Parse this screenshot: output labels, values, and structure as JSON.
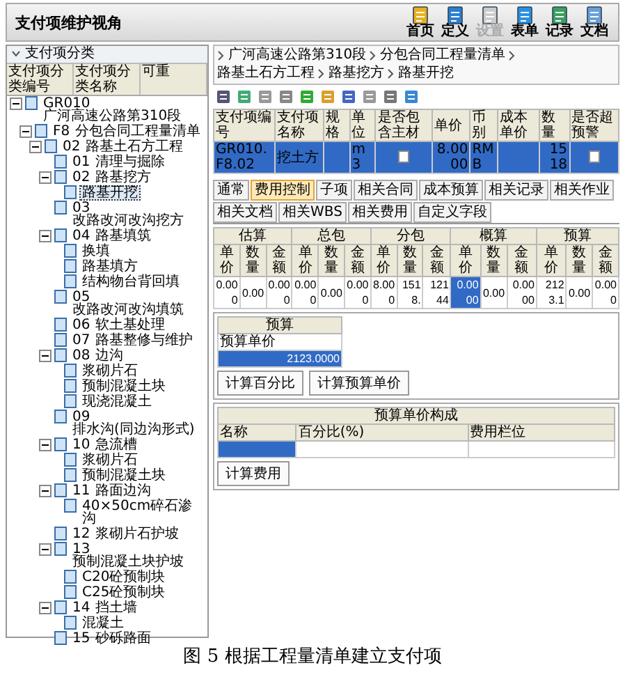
{
  "header": {
    "title": "支付项维护视角",
    "tools": [
      {
        "label": "首页",
        "disabled": false
      },
      {
        "label": "定义",
        "disabled": false
      },
      {
        "label": "设置",
        "disabled": true
      },
      {
        "label": "表单",
        "disabled": false
      },
      {
        "label": "记录",
        "disabled": false
      },
      {
        "label": "文档",
        "disabled": false
      }
    ]
  },
  "tree": {
    "title": "支付项分类",
    "columns": [
      "支付项分类编号",
      "支付项分类名称",
      "可重"
    ],
    "nodes": [
      {
        "code": "GR010",
        "name": "广河高速公路第310段",
        "selected": false,
        "expanded": true,
        "children": [
          {
            "code": "F8",
            "name": "分包合同工程量清单",
            "selected": false,
            "expanded": true,
            "children": [
              {
                "code": "02",
                "name": "路基土石方工程",
                "selected": false,
                "expanded": true,
                "children": [
                  {
                    "code": "01",
                    "name": "清理与掘除",
                    "selected": false
                  },
                  {
                    "code": "02",
                    "name": "路基挖方",
                    "selected": false,
                    "expanded": true,
                    "children": [
                      {
                        "name": "路基开挖",
                        "selected": true
                      }
                    ]
                  },
                  {
                    "code": "03",
                    "name": "改路改河改沟挖方",
                    "selected": false
                  },
                  {
                    "code": "04",
                    "name": "路基填筑",
                    "selected": false,
                    "expanded": true,
                    "children": [
                      {
                        "name": "换填",
                        "selected": false
                      },
                      {
                        "name": "路基填方",
                        "selected": false
                      },
                      {
                        "name": "结构物台背回填",
                        "selected": false
                      }
                    ]
                  },
                  {
                    "code": "05",
                    "name": "改路改河改沟填筑",
                    "selected": false
                  },
                  {
                    "code": "06",
                    "name": "软土基处理",
                    "selected": false
                  },
                  {
                    "code": "07",
                    "name": "路基整修与维护",
                    "selected": false
                  },
                  {
                    "code": "08",
                    "name": "边沟",
                    "selected": false,
                    "expanded": true,
                    "children": [
                      {
                        "name": "浆砌片石",
                        "selected": false
                      },
                      {
                        "name": "预制混凝土块",
                        "selected": false
                      },
                      {
                        "name": "现浇混凝土",
                        "selected": false
                      }
                    ]
                  },
                  {
                    "code": "09",
                    "name": "排水沟(同边沟形式)",
                    "selected": false
                  },
                  {
                    "code": "10",
                    "name": "急流槽",
                    "selected": false,
                    "expanded": true,
                    "children": [
                      {
                        "name": "浆砌片石",
                        "selected": false
                      },
                      {
                        "name": "预制混凝土块",
                        "selected": false
                      }
                    ]
                  },
                  {
                    "code": "11",
                    "name": "路面边沟",
                    "selected": false,
                    "expanded": true,
                    "children": [
                      {
                        "name": "40×50cm碎石渗沟",
                        "selected": false
                      }
                    ]
                  },
                  {
                    "code": "12",
                    "name": "浆砌片石护坡",
                    "selected": false
                  },
                  {
                    "code": "13",
                    "name": "预制混凝土块护坡",
                    "selected": false,
                    "expanded": true,
                    "children": [
                      {
                        "name": "C20砼预制块",
                        "selected": false
                      },
                      {
                        "name": "C25砼预制块",
                        "selected": false
                      }
                    ]
                  },
                  {
                    "code": "14",
                    "name": "挡土墙",
                    "selected": false,
                    "expanded": true,
                    "children": [
                      {
                        "name": "混凝土",
                        "selected": false
                      }
                    ]
                  },
                  {
                    "code": "15",
                    "name": "砂砾路面",
                    "selected": false
                  }
                ]
              }
            ]
          }
        ]
      }
    ]
  },
  "breadcrumb": [
    "广河高速公路第310段",
    "分包合同工程量清单",
    "路基土石方工程",
    "路基挖方",
    "路基开挖"
  ],
  "grid": {
    "columns": [
      "支付项编号",
      "支付项名称",
      "规格",
      "单位",
      "是否包含主材",
      "单价",
      "币别",
      "成本单价",
      "数量",
      "是否超预警"
    ],
    "rows": [
      {
        "selected": true,
        "code": "GR010.F8.02",
        "name": "挖土方",
        "unit": "m3",
        "includes_main_material": false,
        "price": "8.0000",
        "currency": "RMB",
        "quantity": "1518",
        "warning": false
      }
    ]
  },
  "tabs": [
    {
      "label": "通常",
      "selected": false
    },
    {
      "label": "费用控制",
      "selected": true
    },
    {
      "label": "子项",
      "selected": false
    },
    {
      "label": "相关合同",
      "selected": false
    },
    {
      "label": "成本预算",
      "selected": false
    },
    {
      "label": "相关记录",
      "selected": false
    },
    {
      "label": "相关作业",
      "selected": false
    },
    {
      "label": "相关文档",
      "selected": false
    },
    {
      "label": "相关WBS",
      "selected": false
    },
    {
      "label": "相关费用",
      "selected": false
    },
    {
      "label": "自定义字段",
      "selected": false
    }
  ],
  "cost_table": {
    "groups": [
      {
        "title": "估算",
        "subcolumns": [
          "单价",
          "数量",
          "金额"
        ]
      },
      {
        "title": "总包",
        "subcolumns": [
          "单价",
          "数量",
          "金额"
        ]
      },
      {
        "title": "分包",
        "subcolumns": [
          "单价",
          "数量",
          "金额"
        ]
      },
      {
        "title": "概算",
        "subcolumns": [
          "单价",
          "数量",
          "金额"
        ]
      },
      {
        "title": "预算",
        "subcolumns": [
          "单价",
          "数量",
          "金额"
        ]
      }
    ],
    "values": [
      {
        "text": "0.000",
        "selected": false
      },
      {
        "text": "0.00",
        "selected": false
      },
      {
        "text": "0.000",
        "selected": false
      },
      {
        "text": "0.000",
        "selected": false
      },
      {
        "text": "0.00",
        "selected": false
      },
      {
        "text": "0.000",
        "selected": false
      },
      {
        "text": "8.000",
        "selected": false
      },
      {
        "text": "1518.",
        "selected": false
      },
      {
        "text": "12144",
        "selected": false
      },
      {
        "text": "0.0000",
        "selected": true
      },
      {
        "text": "0.00",
        "selected": false
      },
      {
        "text": "0.0000",
        "selected": false
      },
      {
        "text": "2123.1",
        "selected": false
      },
      {
        "text": "0.00",
        "selected": false
      },
      {
        "text": "0.000",
        "selected": false
      }
    ]
  },
  "budget": {
    "title": "预算",
    "row_label": "预算单价",
    "value": "2123.0000",
    "selected": true,
    "buttons": [
      "计算百分比",
      "计算预算单价"
    ]
  },
  "composition": {
    "title": "预算单价构成",
    "columns": [
      "名称",
      "百分比(%)",
      "费用栏位"
    ],
    "selected": true,
    "button": "计算费用"
  },
  "caption": "图 5 根据工程量清单建立支付项"
}
